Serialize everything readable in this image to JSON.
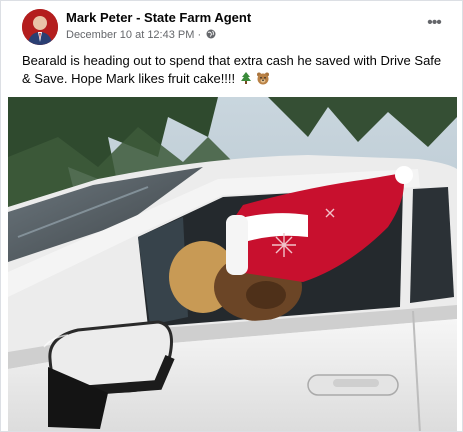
{
  "post": {
    "author": "Mark Peter - State Farm Agent",
    "timestamp": "December 10 at 12:43 PM",
    "separator": "·",
    "audience_icon": "globe-icon",
    "more_options_icon": "more-options-icon",
    "more_options_label": "•••",
    "text": "Bearald is heading out to spend that extra cash he saved with Drive Safe & Save. Hope Mark likes fruit cake!!!!",
    "emojis": [
      "evergreen-tree-emoji",
      "bear-emoji"
    ]
  },
  "photo": {
    "subject": "car-photo",
    "colors": {
      "car_body": "#f2f2f2",
      "hat_red": "#c8102e",
      "bear_brown": "#6b4526",
      "trees": "#2f4a2e"
    }
  }
}
